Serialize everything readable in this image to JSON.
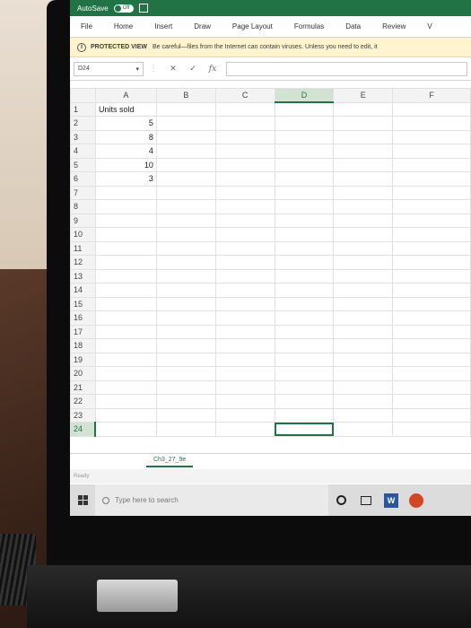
{
  "titlebar": {
    "autosave_label": "AutoSave",
    "autosave_state": "Off"
  },
  "ribbon": {
    "tabs": [
      "File",
      "Home",
      "Insert",
      "Draw",
      "Page Layout",
      "Formulas",
      "Data",
      "Review",
      "V"
    ]
  },
  "protected_view": {
    "title": "PROTECTED VIEW",
    "message": "Be careful—files from the Internet can contain viruses. Unless you need to edit, it"
  },
  "formula_bar": {
    "name_box": "D24",
    "cancel_icon": "✕",
    "enter_icon": "✓",
    "fx_label": "fx",
    "value": ""
  },
  "grid": {
    "columns": [
      "A",
      "B",
      "C",
      "D",
      "E",
      "F"
    ],
    "active_column": "D",
    "active_row": 24,
    "rows": [
      {
        "n": "1",
        "a": "Units sold"
      },
      {
        "n": "2",
        "a": "5"
      },
      {
        "n": "3",
        "a": "8"
      },
      {
        "n": "4",
        "a": "4"
      },
      {
        "n": "5",
        "a": "10"
      },
      {
        "n": "6",
        "a": "3"
      },
      {
        "n": "7",
        "a": ""
      },
      {
        "n": "8",
        "a": ""
      },
      {
        "n": "9",
        "a": ""
      },
      {
        "n": "10",
        "a": ""
      },
      {
        "n": "11",
        "a": ""
      },
      {
        "n": "12",
        "a": ""
      },
      {
        "n": "13",
        "a": ""
      },
      {
        "n": "14",
        "a": ""
      },
      {
        "n": "15",
        "a": ""
      },
      {
        "n": "16",
        "a": ""
      },
      {
        "n": "17",
        "a": ""
      },
      {
        "n": "18",
        "a": ""
      },
      {
        "n": "19",
        "a": ""
      },
      {
        "n": "20",
        "a": ""
      },
      {
        "n": "21",
        "a": ""
      },
      {
        "n": "22",
        "a": ""
      },
      {
        "n": "23",
        "a": ""
      },
      {
        "n": "24",
        "a": ""
      }
    ]
  },
  "sheet_tab": "Ch3_27_9e",
  "status": "Ready",
  "taskbar": {
    "search_placeholder": "Type here to search"
  },
  "colors": {
    "excel_green": "#217346",
    "protected_bg": "#fff4ce"
  }
}
